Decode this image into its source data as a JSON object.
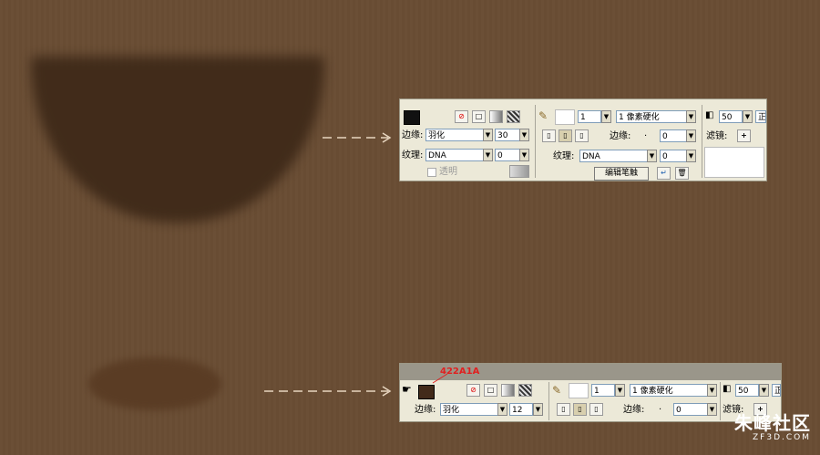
{
  "panel_top": {
    "edge_label": "边缘:",
    "edge_mode": "羽化",
    "edge_value": "30",
    "texture_label": "纹理:",
    "texture_value": "DNA",
    "texture_amount": "0",
    "transparent_label": "透明",
    "stroke_size": "1",
    "stroke_type": "1 像素硬化",
    "edge_label2": "边缘:",
    "edge_value2": "0",
    "texture_label2": "纹理:",
    "texture_value2": "DNA",
    "texture_amount2": "0",
    "edit_stroke_label": "编辑笔触",
    "opacity_value": "50",
    "filters_label": "滤镜:",
    "normal_short": "正"
  },
  "panel_bottom": {
    "color_hex": "422A1A",
    "fill_color": "#422A1A",
    "edge_label": "边缘:",
    "edge_mode": "羽化",
    "edge_value": "12",
    "stroke_size": "1",
    "stroke_type": "1 像素硬化",
    "edge_label2": "边缘:",
    "edge_value2": "0",
    "opacity_value": "50",
    "filters_label": "滤镜:",
    "normal_short": "正"
  },
  "watermark": {
    "brand": "朱峰社区",
    "domain": "ZF3D.COM"
  }
}
